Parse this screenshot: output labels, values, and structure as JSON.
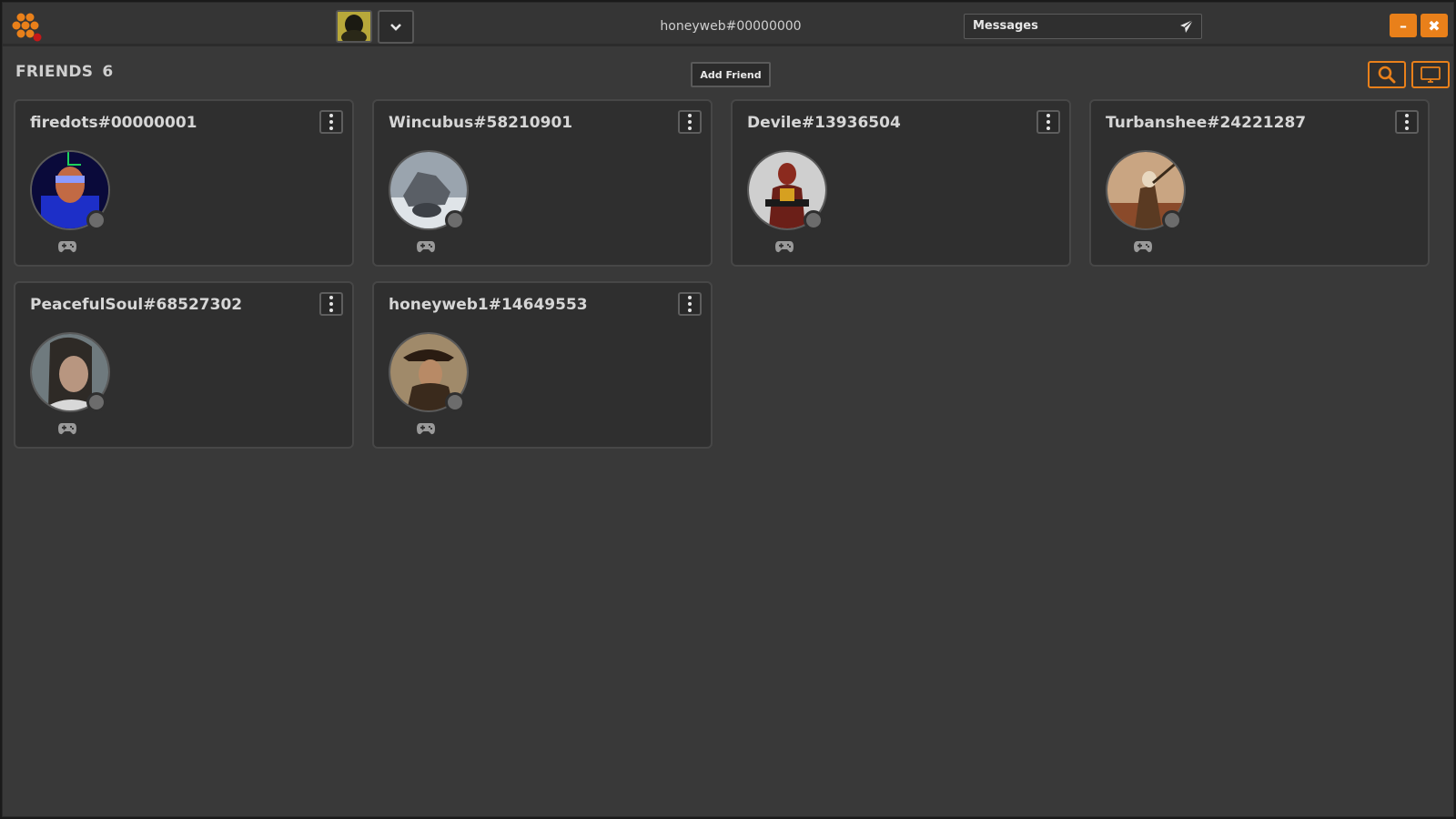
{
  "titlebar": {
    "username": "honeyweb#00000000",
    "messages_label": "Messages",
    "minimize": "–",
    "close": "✖"
  },
  "friends": {
    "title": "FRIENDS",
    "count": "6",
    "add_friend_label": "Add Friend"
  },
  "colors": {
    "accent": "#e9801a",
    "background": "#393939",
    "card": "#2f2f2f",
    "status_offline": "#6c6c6c"
  },
  "cards": [
    {
      "name": "firedots#00000001"
    },
    {
      "name": "Wincubus#58210901"
    },
    {
      "name": "Devile#13936504"
    },
    {
      "name": "Turbanshee#24221287"
    },
    {
      "name": "PeacefulSoul#68527302"
    },
    {
      "name": "honeyweb1#14649553"
    }
  ]
}
